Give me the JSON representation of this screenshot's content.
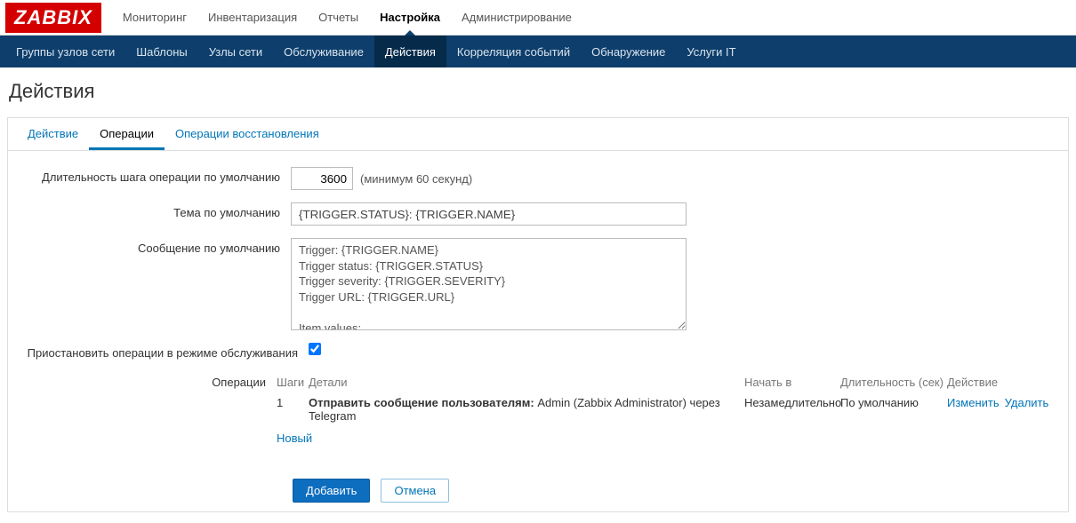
{
  "logo": "ZABBIX",
  "main_menu": {
    "monitoring": "Мониторинг",
    "inventory": "Инвентаризация",
    "reports": "Отчеты",
    "config": "Настройка",
    "admin": "Администрирование"
  },
  "sub_menu": {
    "hostgroups": "Группы узлов сети",
    "templates": "Шаблоны",
    "hosts": "Узлы сети",
    "maintenance": "Обслуживание",
    "actions": "Действия",
    "correlation": "Корреляция событий",
    "discovery": "Обнаружение",
    "itservices": "Услуги IT"
  },
  "page_title": "Действия",
  "tabs": {
    "action": "Действие",
    "operations": "Операции",
    "recovery": "Операции восстановления"
  },
  "form": {
    "step_duration_label": "Длительность шага операции по умолчанию",
    "step_duration_value": "3600",
    "step_duration_hint": "(минимум 60 секунд)",
    "subject_label": "Тема по умолчанию",
    "subject_value": "{TRIGGER.STATUS}: {TRIGGER.NAME}",
    "message_label": "Сообщение по умолчанию",
    "message_value": "Trigger: {TRIGGER.NAME}\nTrigger status: {TRIGGER.STATUS}\nTrigger severity: {TRIGGER.SEVERITY}\nTrigger URL: {TRIGGER.URL}\n\nItem values:\n",
    "pause_label": "Приостановить операции в режиме обслуживания",
    "operations_label": "Операции"
  },
  "ops": {
    "head_steps": "Шаги",
    "head_details": "Детали",
    "head_start": "Начать в",
    "head_dur": "Длительность (сек)",
    "head_action": "Действие",
    "row_step": "1",
    "row_detail_bold": "Отправить сообщение пользователям:",
    "row_detail_rest": " Admin (Zabbix Administrator) через Telegram",
    "row_start": "Незамедлительно",
    "row_dur": "По умолчанию",
    "row_edit": "Изменить",
    "row_delete": "Удалить",
    "new": "Новый"
  },
  "buttons": {
    "add": "Добавить",
    "cancel": "Отмена"
  }
}
